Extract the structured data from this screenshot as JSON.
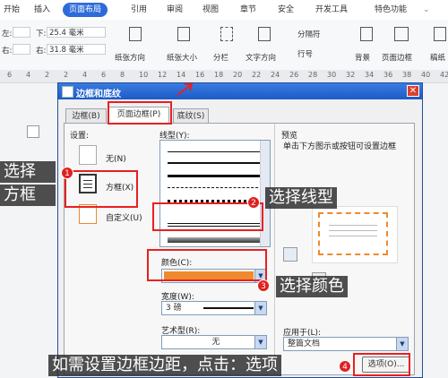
{
  "menubar": {
    "items": [
      "开始",
      "插入",
      "页面布局",
      "引用",
      "审阅",
      "视图",
      "章节",
      "安全",
      "开发工具",
      "特色功能"
    ],
    "active": "页面布局"
  },
  "ribbon": {
    "margin_left_label": "左:",
    "margin_left_value": "—",
    "margin_right_label": "右:",
    "margin_right_value": "31.8 毫米",
    "margin_bottom_label": "下:",
    "margin_bottom_value": "25.4 毫米",
    "orientation": "纸张方向",
    "size": "纸张大小",
    "columns": "分栏",
    "text_direction": "文字方向",
    "break": "分隔符",
    "line_num": "行号",
    "background": "背景",
    "page_border": "页面边框",
    "wrap": "稿纸"
  },
  "ruler": {
    "numbers": [
      "6",
      "4",
      "2",
      "2",
      "4",
      "6",
      "8",
      "10",
      "12",
      "14",
      "16",
      "18",
      "20",
      "22",
      "24",
      "26",
      "28",
      "30",
      "32",
      "34",
      "36",
      "38",
      "40",
      "42"
    ]
  },
  "dialog": {
    "title": "边框和底纹",
    "close": "✕",
    "tabs": [
      "边框(B)",
      "页面边框(P)",
      "底纹(S)"
    ],
    "setting_label": "设置:",
    "settings": [
      "无(N)",
      "方框(X)",
      "自定义(U)"
    ],
    "line_style_label": "线型(Y):",
    "color_label": "颜色(C):",
    "color_value": "#ef8a2e",
    "width_label": "宽度(W):",
    "width_value": "3 磅",
    "art_label": "艺术型(R):",
    "art_value": "无",
    "preview_label": "预览",
    "preview_hint": "单击下方图示或按钮可设置边框",
    "apply_label": "应用于(L):",
    "apply_value": "整篇文档",
    "options_button": "选项(O)..."
  },
  "annotations": {
    "step1": "选择\n方框",
    "step1_line1": "选择",
    "step1_line2": "方框",
    "step2": "选择线型",
    "step3": "选择颜色",
    "step4": "如需设置边框边距，点击：选项",
    "badges": [
      "1",
      "2",
      "3",
      "4"
    ]
  },
  "colors": {
    "accent": "#2d6bd9",
    "annotation_red": "#e82020",
    "border_orange": "#ef8a2e"
  }
}
